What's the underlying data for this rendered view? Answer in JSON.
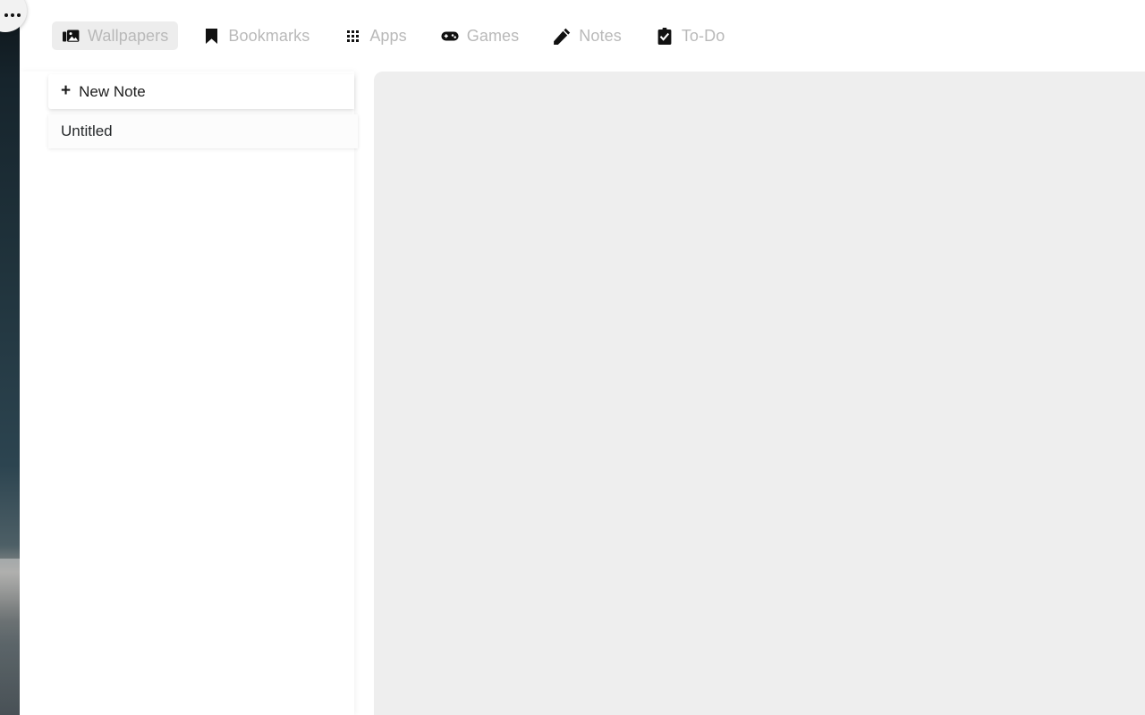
{
  "window": {
    "overflow_menu_label": "More options"
  },
  "tabbar": {
    "tabs": [
      {
        "id": "wallpapers",
        "label": "Wallpapers",
        "icon": "image-icon",
        "active": true
      },
      {
        "id": "bookmarks",
        "label": "Bookmarks",
        "icon": "bookmark-icon",
        "active": false
      },
      {
        "id": "apps",
        "label": "Apps",
        "icon": "grid-apps-icon",
        "active": false
      },
      {
        "id": "games",
        "label": "Games",
        "icon": "gamepad-icon",
        "active": false
      },
      {
        "id": "notes",
        "label": "Notes",
        "icon": "pencil-icon",
        "active": false
      },
      {
        "id": "todo",
        "label": "To-Do",
        "icon": "clipboard-check-icon",
        "active": false
      }
    ]
  },
  "notes_sidebar": {
    "new_note_label": "New Note",
    "new_note_icon": "plus-icon",
    "notes": [
      {
        "title": "Untitled",
        "selected": true
      }
    ]
  },
  "note_editor": {
    "content": "",
    "placeholder": ""
  },
  "colors": {
    "tab_label": "#b9b9b9",
    "tab_active_bg": "#ededed",
    "editor_bg": "#eeeeee",
    "sidebar_bg": "#ffffff",
    "icon": "#111111"
  }
}
